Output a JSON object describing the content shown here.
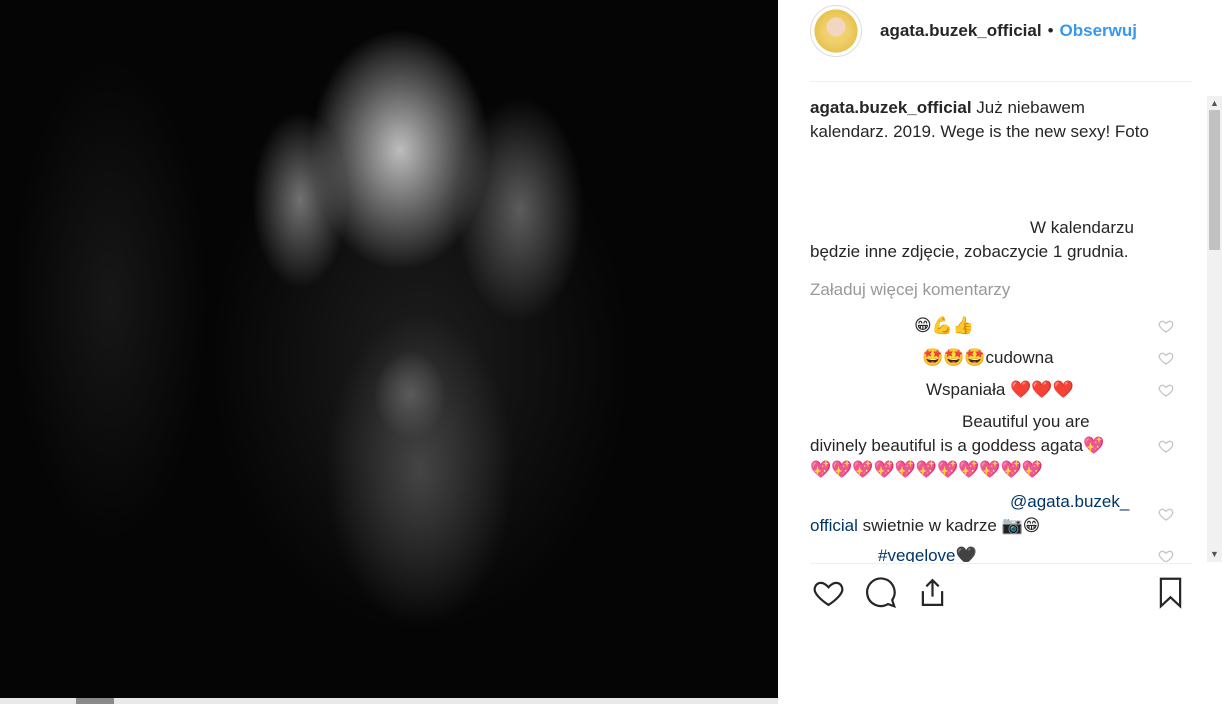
{
  "header": {
    "username": "agata.buzek_official",
    "separator": "•",
    "follow_label": "Obserwuj"
  },
  "caption": {
    "username": "agata.buzek_official",
    "line1": "Już niebawem",
    "line2": "kalendarz. 2019. Wege is the new sexy! Foto",
    "line3": "W kalendarzu",
    "line4": "będzie inne zdjęcie, zobaczycie 1 grudnia."
  },
  "load_more_label": "Załaduj więcej komentarzy",
  "comments": [
    {
      "text": "😁💪👍"
    },
    {
      "emoji": "🤩🤩🤩",
      "text": "cudowna"
    },
    {
      "text": "Wspaniała",
      "emoji": "❤️❤️❤️"
    },
    {
      "line1": "Beautiful you are",
      "line2": "divinely beautiful is a goddess agata",
      "line2_emoji": "💖",
      "line3": "💖💖💖💖💖💖💖💖💖💖💖"
    },
    {
      "mention": "@agata.buzek_",
      "mention2": "official",
      "text": " swietnie w kadrze ",
      "emoji": "📷😁"
    },
    {
      "hashtag": "#vegelove",
      "emoji": "🖤"
    }
  ],
  "colors": {
    "link_blue": "#3897f0",
    "text": "#262626",
    "muted": "#999999",
    "divider": "#efefef"
  },
  "icons": {
    "like": "heart-icon",
    "comment": "comment-icon",
    "share": "share-icon",
    "save": "bookmark-icon"
  }
}
